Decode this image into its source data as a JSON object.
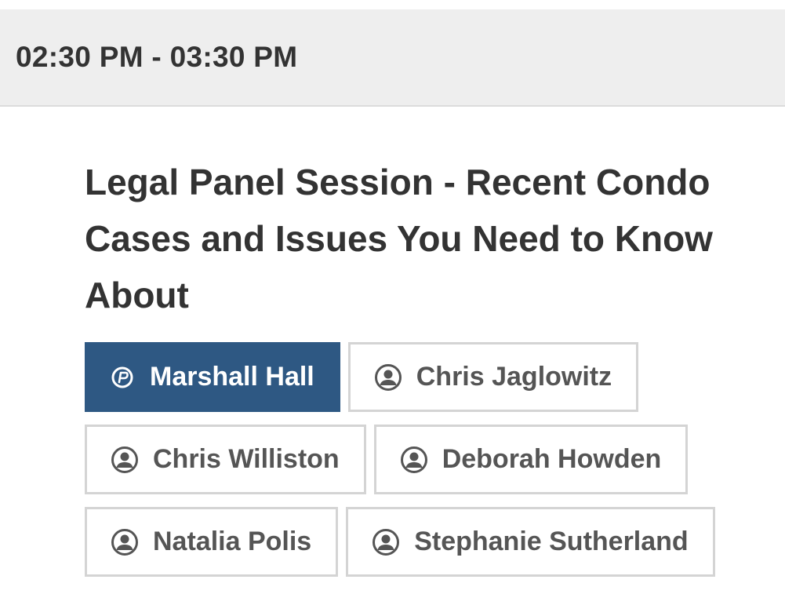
{
  "session_block": {
    "time_range": "02:30 PM - 03:30 PM",
    "title": "Legal Panel Session - Recent Condo Cases and Issues You Need to Know About",
    "speakers": [
      {
        "name": "Marshall Hall",
        "active": true,
        "icon": "moderator-icon"
      },
      {
        "name": "Chris Jaglowitz",
        "active": false,
        "icon": "user-icon"
      },
      {
        "name": "Chris Williston",
        "active": false,
        "icon": "user-icon"
      },
      {
        "name": "Deborah Howden",
        "active": false,
        "icon": "user-icon"
      },
      {
        "name": "Natalia Polis",
        "active": false,
        "icon": "user-icon"
      },
      {
        "name": "Stephanie Sutherland",
        "active": false,
        "icon": "user-icon"
      }
    ]
  },
  "colors": {
    "active_chip_bg": "#2e5883",
    "time_bar_bg": "#eeeeee",
    "text": "#333333",
    "chip_text": "#555555",
    "chip_border": "#d4d4d4"
  }
}
